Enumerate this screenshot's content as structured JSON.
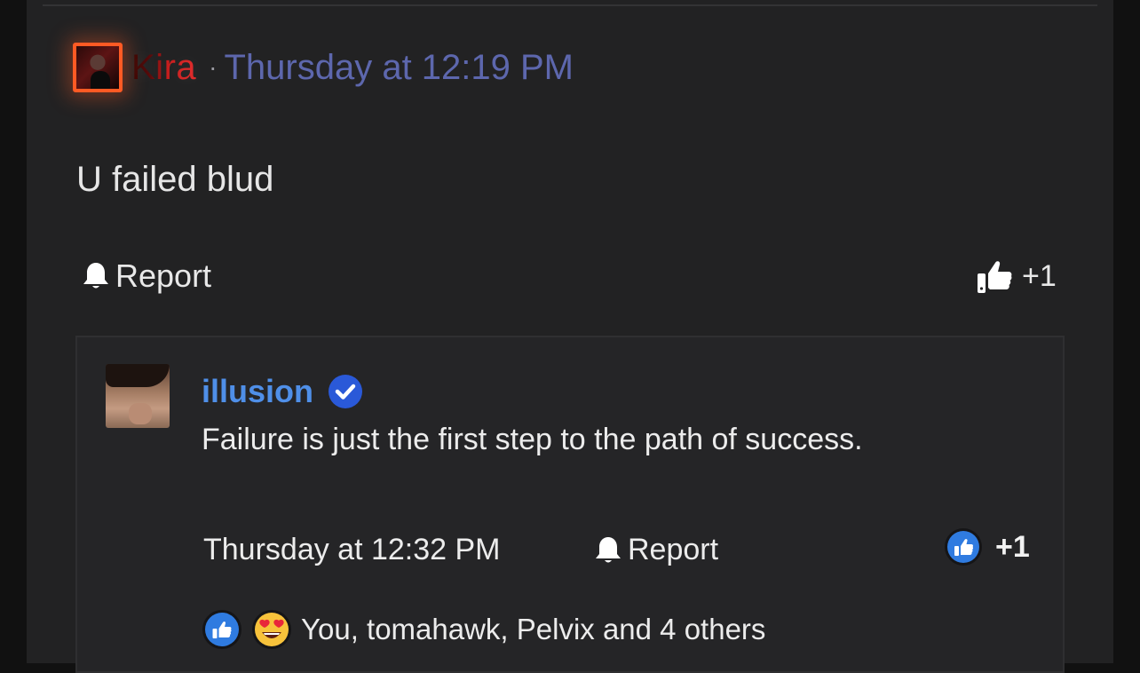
{
  "post": {
    "author": "Kira",
    "separator": "·",
    "timestamp": "Thursday at 12:19 PM",
    "body": "U failed blud",
    "report_label": "Report",
    "like_count": "+1"
  },
  "reply": {
    "author": "illusion",
    "text": "Failure is just the first step to the path of success.",
    "timestamp": "Thursday at 12:32 PM",
    "report_label": "Report",
    "like_count": "+1",
    "reactions_summary": "You, tomahawk, Pelvix and 4 others"
  },
  "icons": {
    "report": "bell-icon",
    "like": "thumbs-up-icon",
    "verified": "verified-check-icon",
    "reaction_like": "like-reaction-icon",
    "reaction_love": "heart-eyes-emoji-icon"
  },
  "colors": {
    "background": "#222223",
    "author_kira": "#e02a2a",
    "timestamp": "#5d67ad",
    "author_illusion": "#4f8fe8",
    "verified": "#2a59d8",
    "avatar_border": "#ff5a24"
  }
}
